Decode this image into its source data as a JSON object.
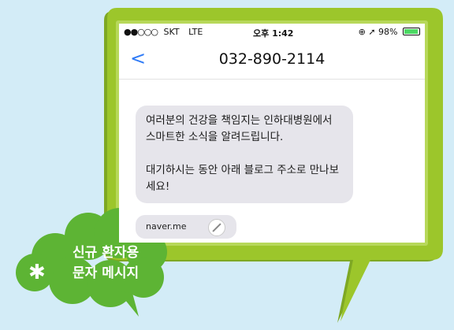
{
  "status_bar": {
    "signal_dots": "●●○○○",
    "carrier": "SKT",
    "network": "LTE",
    "time": "오후 1:42",
    "right_icons": "⊕ ➚",
    "battery": "98%",
    "battery_level": 0.98
  },
  "nav": {
    "back_label": "<",
    "title": "032-890-2114"
  },
  "message": {
    "paragraph1": "여러분의 건강을 책임지는 인하대병원에서 스마트한 소식을 알려드립니다.",
    "paragraph2": "대기하시는 동안 아래 블로그 주소로 만나보세요!"
  },
  "link_preview": {
    "url": "naver.me",
    "icon": "compass-icon"
  },
  "badge": {
    "line1": "신규 환자용",
    "line2": "문자 메시지",
    "symbol": "✱"
  },
  "colors": {
    "background": "#d3ecf7",
    "frame_green": "#9cc62b",
    "frame_dark": "#6e9a1c",
    "cloud_green": "#5db434",
    "ios_blue": "#2f7bf6",
    "bubble_gray": "#e6e5eb"
  }
}
